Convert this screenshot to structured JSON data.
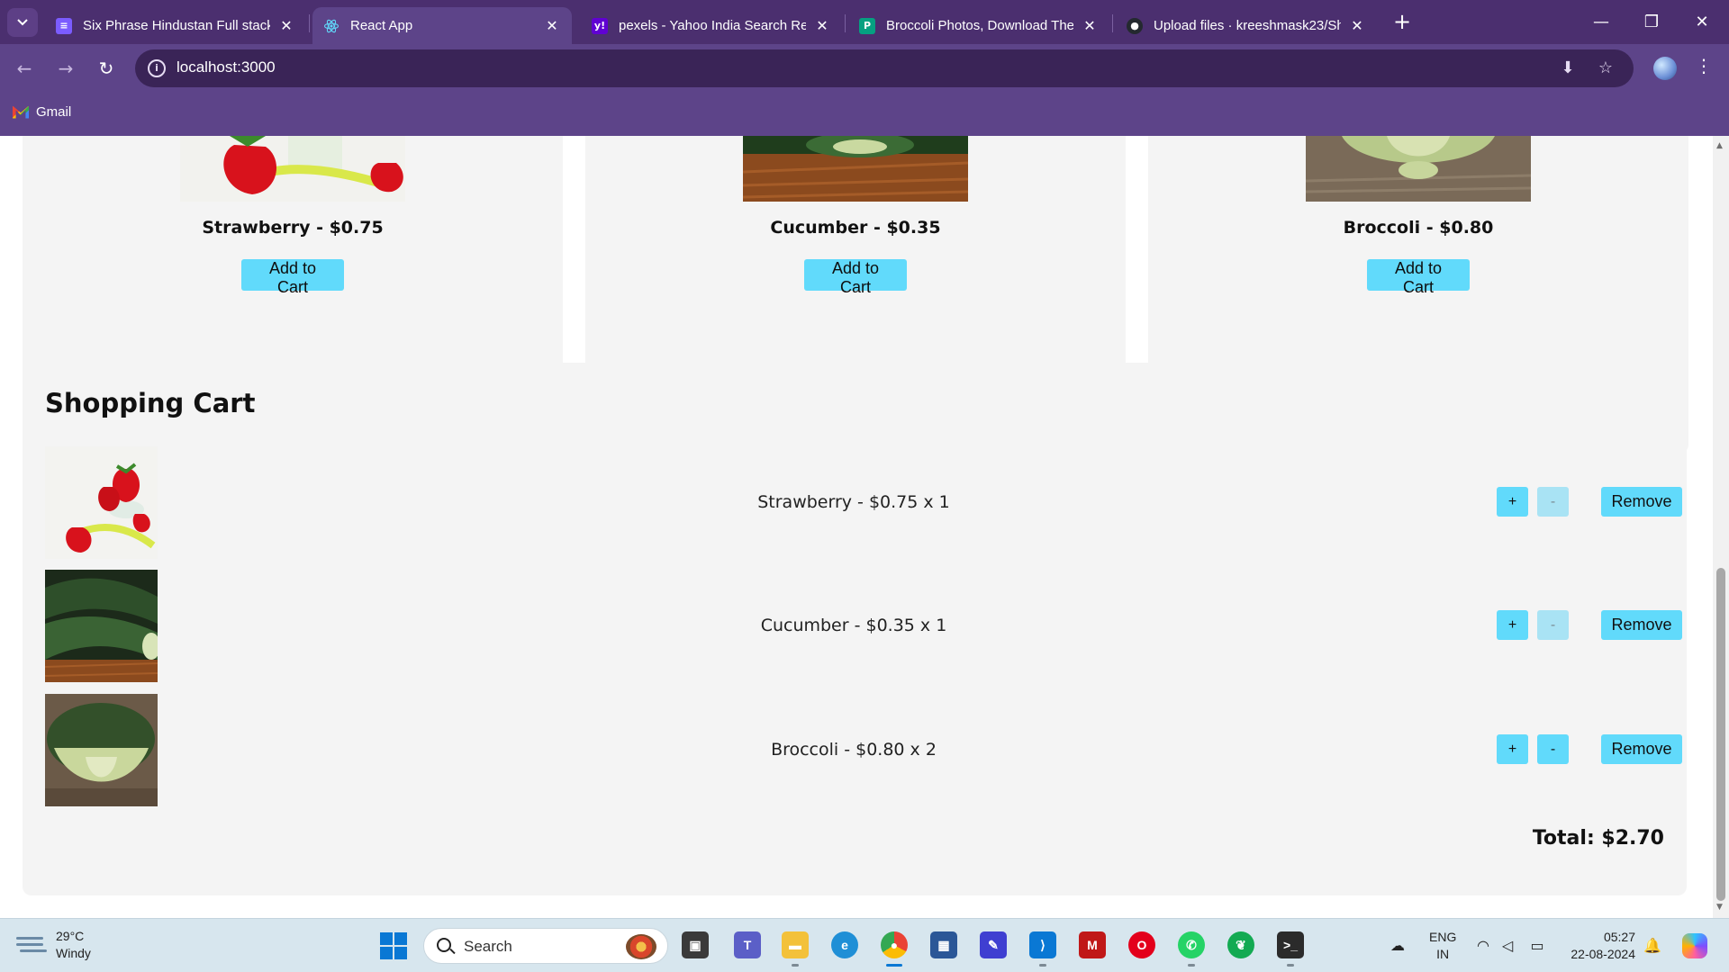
{
  "browser": {
    "tabs": [
      {
        "title": "Six Phrase Hindustan Full stack",
        "active": false,
        "favicon": "list-icon",
        "color": "#7b5cff"
      },
      {
        "title": "React App",
        "active": true,
        "favicon": "react-icon",
        "color": "#61dafb"
      },
      {
        "title": "pexels - Yahoo India Search Res",
        "active": false,
        "favicon": "yahoo-icon",
        "color": "#6001d2"
      },
      {
        "title": "Broccoli Photos, Download The",
        "active": false,
        "favicon": "pexels-icon",
        "color": "#05a081"
      },
      {
        "title": "Upload files · kreeshmask23/Sh",
        "active": false,
        "favicon": "github-icon",
        "color": "#24292f"
      }
    ],
    "url": "localhost:3000",
    "bookmarks": [
      {
        "label": "Gmail",
        "icon": "gmail-icon"
      }
    ]
  },
  "products": [
    {
      "name_price": "Strawberry - $0.75",
      "button": "Add to Cart",
      "image": "strawberry"
    },
    {
      "name_price": "Cucumber - $0.35",
      "button": "Add to Cart",
      "image": "cucumber"
    },
    {
      "name_price": "Broccoli - $0.80",
      "button": "Add to Cart",
      "image": "broccoli"
    }
  ],
  "cart": {
    "title": "Shopping Cart",
    "items": [
      {
        "text": "Strawberry - $0.75 x 1",
        "plus": "+",
        "minus": "-",
        "remove": "Remove",
        "minus_disabled": true,
        "image": "strawberry"
      },
      {
        "text": "Cucumber - $0.35 x 1",
        "plus": "+",
        "minus": "-",
        "remove": "Remove",
        "minus_disabled": true,
        "image": "cucumber"
      },
      {
        "text": "Broccoli - $0.80 x 2",
        "plus": "+",
        "minus": "-",
        "remove": "Remove",
        "minus_disabled": false,
        "image": "broccoli"
      }
    ],
    "total": "Total: $2.70"
  },
  "taskbar": {
    "weather": {
      "temp": "29°C",
      "condition": "Windy"
    },
    "search_placeholder": "Search",
    "language": {
      "line1": "ENG",
      "line2": "IN"
    },
    "clock": {
      "time": "05:27",
      "date": "22-08-2024"
    }
  },
  "colors": {
    "accent": "#61dafb",
    "chrome_dark": "#4b2f6f",
    "chrome": "#5d4489",
    "card": "#f4f4f4"
  }
}
